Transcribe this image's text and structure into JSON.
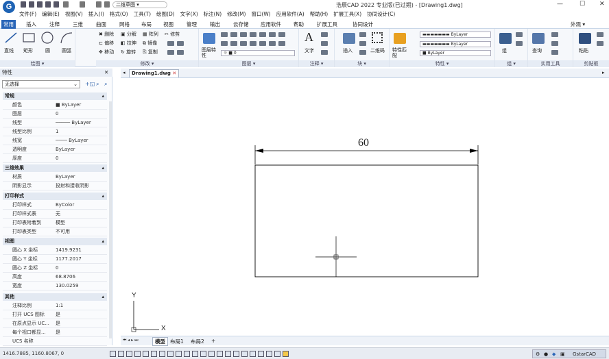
{
  "app": {
    "logo_letter": "G",
    "window_title": "浩辰CAD 2022 专业版(已过期) - [Drawing1.dwg]",
    "workspace": "二维草图",
    "controls": {
      "minimize": "—",
      "maximize": "☐",
      "close": "✕"
    }
  },
  "menu": [
    "文件(F)",
    "编辑(E)",
    "视图(V)",
    "插入(I)",
    "格式(O)",
    "工具(T)",
    "绘图(D)",
    "文字(X)",
    "标注(N)",
    "修改(M)",
    "窗口(W)",
    "应用软件(A)",
    "帮助(H)",
    "扩展工具(X)",
    "协同设计(C)"
  ],
  "tabs": [
    "常用",
    "插入",
    "注释",
    "三维",
    "曲面",
    "网格",
    "布局",
    "视图",
    "管理",
    "输出",
    "云存储",
    "应用软件",
    "帮助",
    "扩展工具",
    "协同设计"
  ],
  "appearance_label": "外观 ▾",
  "ribbon": {
    "draw": {
      "title": "绘图 ▾",
      "line": "直线",
      "rect": "矩形",
      "circle": "圆",
      "arc": "圆弧"
    },
    "modify": {
      "title": "修改 ▾",
      "items": [
        "删除",
        "分解",
        "偏移",
        "拉伸",
        "移动",
        "旋转",
        "镜像",
        "复制",
        "阵列",
        "修剪"
      ]
    },
    "layers": {
      "title": "图层 ▾",
      "prop_label": "图层特性",
      "layer_value": "0"
    },
    "annotate": {
      "title": "注释 ▾",
      "text": "文字"
    },
    "block": {
      "title": "块 ▾",
      "insert": "插入",
      "qrcode": "二维码"
    },
    "properties": {
      "title": "特性 ▾",
      "match": "特性匹配",
      "color": "ByLayer",
      "linetype": "ByLayer",
      "lineweight": "ByLayer"
    },
    "group": {
      "title": "组 ▾",
      "group": "组"
    },
    "utilities": {
      "title": "实用工具",
      "query": "查询"
    },
    "clipboard": {
      "title": "剪贴板",
      "paste": "粘贴"
    }
  },
  "properties_panel": {
    "title": "特性",
    "selection": "无选择",
    "sections": [
      {
        "name": "常规",
        "rows": [
          [
            "颜色",
            "ByLayer"
          ],
          [
            "图层",
            "0"
          ],
          [
            "线型",
            "ByLayer"
          ],
          [
            "线型比例",
            "1"
          ],
          [
            "线宽",
            "ByLayer"
          ],
          [
            "透明度",
            "ByLayer"
          ],
          [
            "厚度",
            "0"
          ]
        ]
      },
      {
        "name": "三维效果",
        "rows": [
          [
            "材质",
            "ByLayer"
          ],
          [
            "阴影显示",
            "投射和接收阴影"
          ]
        ]
      },
      {
        "name": "打印样式",
        "rows": [
          [
            "打印样式",
            "ByColor"
          ],
          [
            "打印样式表",
            "无"
          ],
          [
            "打印表附着到",
            "模型"
          ],
          [
            "打印表类型",
            "不可用"
          ]
        ]
      },
      {
        "name": "视图",
        "rows": [
          [
            "圆心 X 坐标",
            "1419.9231"
          ],
          [
            "圆心 Y 坐标",
            "1177.2017"
          ],
          [
            "圆心 Z 坐标",
            "0"
          ],
          [
            "高度",
            "68.8706"
          ],
          [
            "宽度",
            "130.0259"
          ]
        ]
      },
      {
        "name": "其他",
        "rows": [
          [
            "注释比例",
            "1:1"
          ],
          [
            "打开 UCS 图标",
            "是"
          ],
          [
            "在原点显示 UC...",
            "是"
          ],
          [
            "每个视口都显...",
            "是"
          ],
          [
            "UCS 名称",
            ""
          ]
        ]
      }
    ]
  },
  "document_tab": "Drawing1.dwg",
  "drawing": {
    "dimension_text": "60",
    "ucs_x": "X",
    "ucs_y": "Y"
  },
  "layout_tabs": [
    "模型",
    "布局1",
    "布局2"
  ],
  "status": {
    "coords": "1416.7885, 1160.8067, 0",
    "brand": "GstarCAD"
  }
}
